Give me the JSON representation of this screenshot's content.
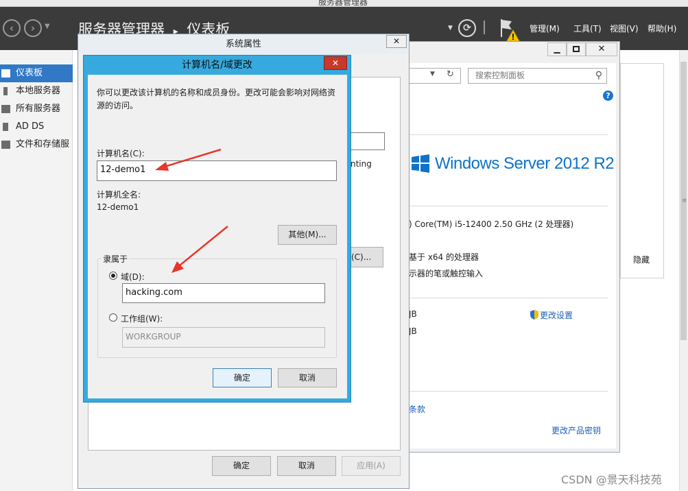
{
  "server_manager": {
    "window_title": "服务器管理器",
    "breadcrumb": {
      "root": "服务器管理器",
      "sep": "▸",
      "current": "仪表板"
    },
    "menu": {
      "manage": "管理(M)",
      "tools": "工具(T)",
      "view": "视图(V)",
      "help": "帮助(H)"
    },
    "sidebar": [
      {
        "label": "仪表板"
      },
      {
        "label": "本地服务器"
      },
      {
        "label": "所有服务器"
      },
      {
        "label": "AD DS"
      },
      {
        "label": "文件和存储服"
      }
    ],
    "hide_label": "隐藏"
  },
  "system_window": {
    "search_placeholder": "搜索控制面板",
    "os_brand": "Windows Server 2012 R2",
    "processor": ") Core(TM) i5-12400   2.50 GHz  (2 处理器)",
    "system_type": "基于 x64 的处理器",
    "pen_touch": "示器的笔或触控输入",
    "ram_1": "JB",
    "ram_2": "JB",
    "change_settings": "更改设置",
    "terms_fragment": "条款",
    "change_product_key": "更改产品密钥"
  },
  "system_properties": {
    "title": "系统属性",
    "partial_text": "nting",
    "partial_button": "(C)...",
    "ok": "确定",
    "cancel": "取消",
    "apply": "应用(A)"
  },
  "computer_name_dialog": {
    "title": "计算机名/域更改",
    "description_1": "你可以更改该计算机的名称和成员身份。更改可能会影响对网络资",
    "description_2": "源的访问。",
    "computer_name_label": "计算机名(C):",
    "computer_name_value": "12-demo1",
    "full_name_label": "计算机全名:",
    "full_name_value": "12-demo1",
    "more_button": "其他(M)...",
    "member_of_label": "隶属于",
    "domain_label": "域(D):",
    "domain_value": "hacking.com",
    "workgroup_label": "工作组(W):",
    "workgroup_value": "WORKGROUP",
    "ok": "确定",
    "cancel": "取消"
  },
  "watermark": "CSDN @景天科技苑",
  "colors": {
    "accent_blue": "#36aadf",
    "arrow_red": "#e8362b",
    "nav_active": "#3179c4",
    "header_dark": "#3b3b3b"
  }
}
